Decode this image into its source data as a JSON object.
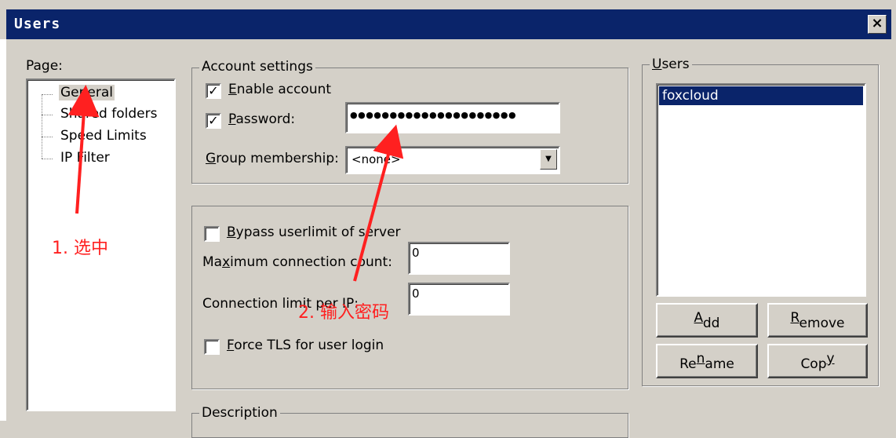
{
  "window": {
    "title": "Users",
    "close_icon": "close-icon"
  },
  "page_panel": {
    "label": "Page:",
    "tree_items": [
      "General",
      "Shared folders",
      "Speed Limits",
      "IP Filter"
    ]
  },
  "account_settings": {
    "legend": "Account settings",
    "enable_account": {
      "label_underlined": "E",
      "label_rest": "nable account",
      "checked": true
    },
    "password": {
      "label_underlined": "P",
      "label_rest": "assword:",
      "checked": true,
      "value": "●●●●●●●●●●●●●●●●●●●●●"
    },
    "group_membership": {
      "label_underlined": "G",
      "label_rest": "roup membership:",
      "value": "<none>"
    }
  },
  "limits": {
    "bypass": {
      "label_underlined": "B",
      "label_rest": "ypass userlimit of server",
      "checked": false
    },
    "max_conn": {
      "label_pre": "Ma",
      "label_underlined": "x",
      "label_rest": "imum connection count:",
      "value": "0"
    },
    "conn_per_ip": {
      "label": "Connection limit per IP:",
      "value": "0"
    },
    "force_tls": {
      "label_underlined": "F",
      "label_rest": "orce TLS for user login",
      "checked": false
    }
  },
  "description": {
    "legend": "Description"
  },
  "users_panel": {
    "legend_underlined": "U",
    "legend_rest": "sers",
    "list": [
      "foxcloud"
    ],
    "buttons": {
      "add": {
        "underlined": "A",
        "rest": "dd"
      },
      "remove": {
        "underlined": "R",
        "rest": "emove"
      },
      "rename": {
        "pre": "Re",
        "underlined": "n",
        "rest": "ame"
      },
      "copy": {
        "pre": "Cop",
        "underlined": "y",
        "rest": ""
      }
    }
  },
  "annotations": {
    "step1": "1. 选中",
    "step2": "2. 输入密码",
    "color": "#ff2020"
  }
}
